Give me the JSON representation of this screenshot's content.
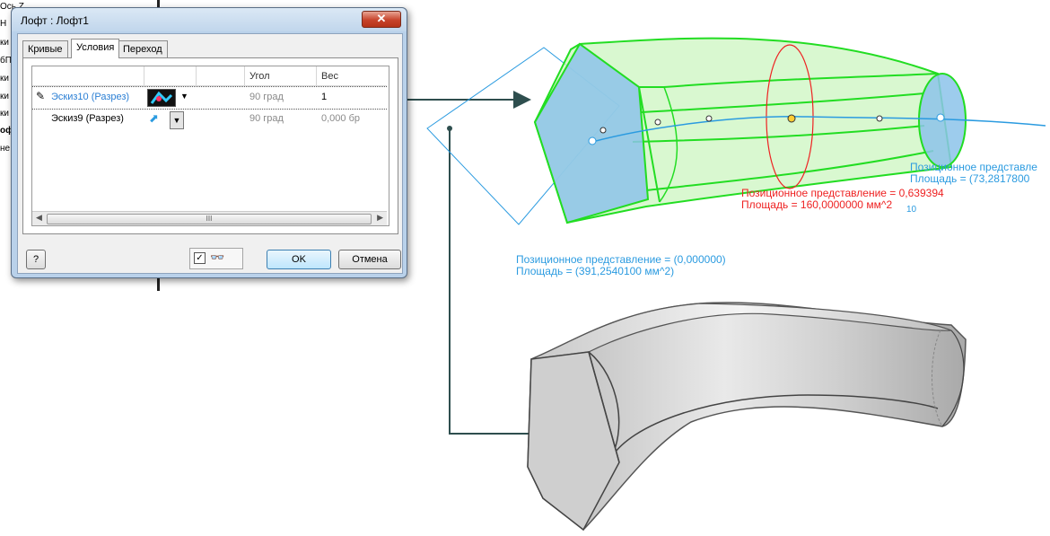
{
  "left_strip": [
    "Ось Z",
    "Н",
    "ки",
    "бП",
    "ки",
    "ки",
    "ки",
    "оф",
    "не"
  ],
  "dialog": {
    "title": "Лофт : Лофт1",
    "close_label": "✕",
    "tabs": [
      "Кривые",
      "Условия",
      "Переход"
    ],
    "active_tab": "Условия",
    "columns": [
      "Угол",
      "Вес"
    ],
    "rows": [
      {
        "name": "Эскиз10 (Разрез)",
        "angle": "90 град",
        "weight": "1",
        "selected": true
      },
      {
        "name": "Эскиз9 (Разрез)",
        "angle": "90 град",
        "weight": "0,000 бр",
        "selected": false
      }
    ],
    "scroll_thumb": "III",
    "help_label": "?",
    "ok_label": "OK",
    "cancel_label": "Отмена"
  },
  "annotations": {
    "left_section_1": "Позиционное представление = (0,000000)",
    "left_section_2": "Площадь = (391,2540100 мм^2)",
    "mid_section_1": "Позиционное представление = 0,639394",
    "mid_section_2": "Площадь = 160,0000000 мм^2",
    "right_section_1": "Позиционное представле",
    "right_section_2": "Площадь = (73,2817800",
    "tick_label": "10"
  },
  "colors": {
    "loft_green": "#22dd22",
    "section_blue": "#2b9be0",
    "mid_red": "#ee2222",
    "arrow_dark": "#2e4e4e",
    "dialog_frame": "#b9d1ea"
  }
}
